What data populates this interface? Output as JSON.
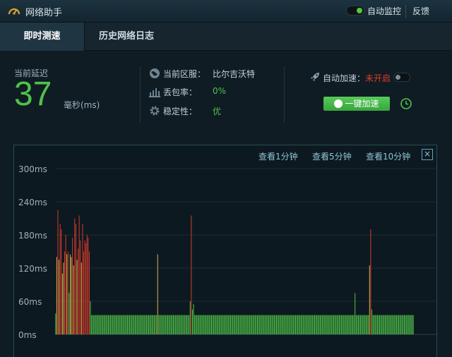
{
  "app": {
    "title": "网络助手",
    "monitor_label": "自动监控",
    "monitor_on": true,
    "feedback_label": "反馈",
    "icons": {
      "logo": "speedometer-icon"
    }
  },
  "tabs": [
    {
      "label": "即时测速",
      "active": true
    },
    {
      "label": "历史网络日志",
      "active": false
    }
  ],
  "latency": {
    "label": "当前延迟",
    "value": "37",
    "unit": "毫秒(ms)"
  },
  "stats": {
    "region": {
      "label": "当前区服：",
      "value": "比尔吉沃特",
      "icon": "globe-icon"
    },
    "loss": {
      "label": "丢包率：",
      "value": "0%",
      "icon": "signal-bars-icon"
    },
    "stability": {
      "label": "稳定性：",
      "value": "优",
      "icon": "gear-icon"
    }
  },
  "accelerate": {
    "label": "自动加速：",
    "status": "未开启",
    "enabled": false,
    "button_label": "一键加速",
    "icon": "rocket-icon",
    "history_icon": "clock-icon"
  },
  "ranges": [
    "查看1分钟",
    "查看5分钟",
    "查看10分钟"
  ],
  "colors": {
    "good": "#4fc24a",
    "warn": "#d6b24a",
    "bad": "#d43a2a",
    "accent": "#56c63d",
    "status_off": "#e23a2c"
  },
  "chart_data": {
    "type": "bar",
    "ylim": [
      0,
      300
    ],
    "yticks": [
      "300ms",
      "240ms",
      "180ms",
      "120ms",
      "60ms",
      "0ms"
    ],
    "ytick_values": [
      300,
      240,
      180,
      120,
      60,
      0
    ],
    "grid": true,
    "thresholds": {
      "warn": 80,
      "bad": 150
    },
    "values": [
      38,
      140,
      225,
      135,
      200,
      190,
      110,
      130,
      150,
      180,
      145,
      150,
      75,
      145,
      140,
      175,
      125,
      210,
      200,
      135,
      155,
      215,
      170,
      130,
      200,
      150,
      170,
      165,
      180,
      175,
      150,
      60,
      35,
      35,
      35,
      35,
      35,
      35,
      35,
      35,
      35,
      35,
      35,
      35,
      35,
      35,
      35,
      35,
      35,
      35,
      35,
      35,
      35,
      35,
      35,
      35,
      35,
      35,
      35,
      35,
      35,
      35,
      35,
      35,
      35,
      35,
      35,
      35,
      35,
      35,
      35,
      35,
      35,
      35,
      35,
      35,
      35,
      35,
      35,
      35,
      35,
      35,
      35,
      35,
      35,
      35,
      35,
      35,
      35,
      35,
      35,
      145,
      35,
      35,
      35,
      35,
      35,
      35,
      35,
      35,
      35,
      35,
      35,
      35,
      35,
      35,
      35,
      35,
      35,
      35,
      35,
      35,
      35,
      35,
      35,
      35,
      35,
      35,
      35,
      35,
      60,
      215,
      45,
      55,
      35,
      35,
      35,
      35,
      35,
      35,
      35,
      35,
      35,
      35,
      35,
      35,
      35,
      35,
      35,
      35,
      35,
      35,
      35,
      35,
      35,
      35,
      35,
      35,
      35,
      35,
      35,
      35,
      35,
      35,
      35,
      35,
      35,
      35,
      35,
      35,
      35,
      35,
      35,
      35,
      35,
      35,
      35,
      35,
      35,
      35,
      35,
      35,
      35,
      35,
      35,
      35,
      35,
      35,
      35,
      35,
      35,
      35,
      35,
      35,
      35,
      35,
      35,
      35,
      35,
      35,
      35,
      35,
      35,
      35,
      35,
      35,
      35,
      35,
      35,
      35,
      35,
      35,
      35,
      35,
      35,
      35,
      35,
      35,
      35,
      35,
      35,
      35,
      35,
      35,
      35,
      35,
      35,
      35,
      35,
      35,
      35,
      35,
      35,
      35,
      35,
      35,
      35,
      35,
      35,
      35,
      35,
      35,
      35,
      35,
      35,
      35,
      35,
      35,
      35,
      35,
      35,
      35,
      35,
      35,
      35,
      35,
      35,
      35,
      35,
      35,
      35,
      35,
      35,
      35,
      35,
      35,
      35,
      35,
      35,
      35,
      35,
      35,
      35,
      35,
      35,
      35,
      35,
      75,
      35,
      35,
      35,
      35,
      35,
      35,
      35,
      35,
      35,
      35,
      35,
      35,
      125,
      190,
      45,
      35,
      35,
      35,
      35,
      35,
      35,
      35,
      35,
      35,
      35,
      35,
      35,
      35,
      35,
      35,
      35,
      35,
      35,
      35,
      35,
      35,
      35,
      35,
      35,
      35,
      35,
      35,
      35,
      35,
      35,
      35,
      35,
      35,
      35,
      35,
      35,
      35
    ]
  }
}
